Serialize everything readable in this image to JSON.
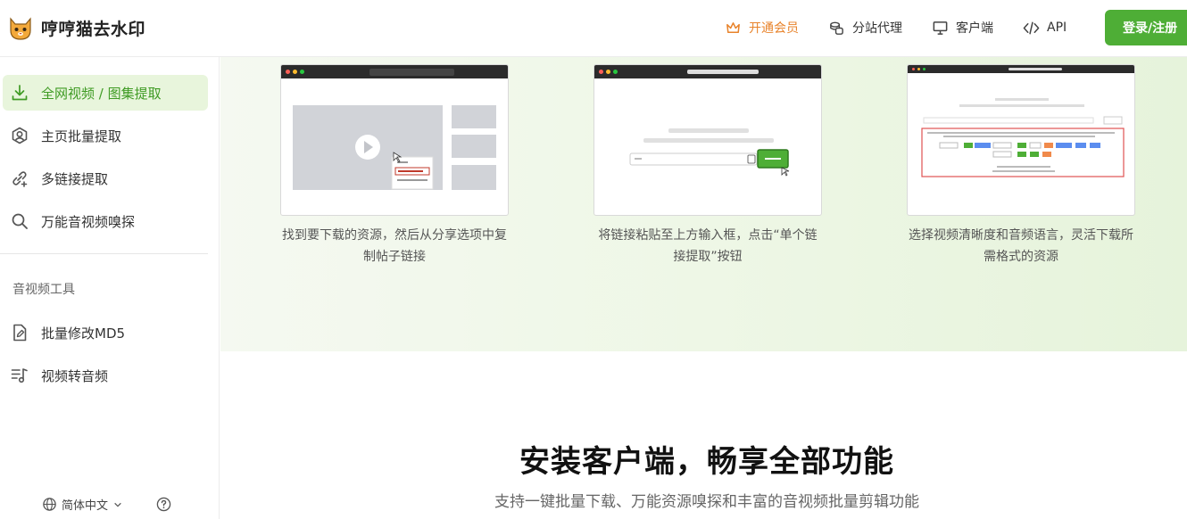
{
  "brand": {
    "name": "哼哼猫去水印"
  },
  "nav": {
    "vip": "开通会员",
    "agent": "分站代理",
    "client": "客户端",
    "api": "API",
    "login": "登录/注册"
  },
  "sidebar": {
    "items": [
      {
        "label": "全网视频 / 图集提取",
        "icon": "download-icon"
      },
      {
        "label": "主页批量提取",
        "icon": "user-circle-icon"
      },
      {
        "label": "多链接提取",
        "icon": "link-add-icon"
      },
      {
        "label": "万能音视频嗅探",
        "icon": "search-icon"
      }
    ],
    "section_title": "音视频工具",
    "tools": [
      {
        "label": "批量修改MD5",
        "icon": "file-edit-icon"
      },
      {
        "label": "视频转音频",
        "icon": "music-list-icon"
      }
    ],
    "language": "简体中文"
  },
  "steps": [
    {
      "caption": "找到要下载的资源，然后从分享选项中复制帖子链接"
    },
    {
      "caption": "将链接粘贴至上方输入框，点击“单个链接提取”按钮"
    },
    {
      "caption": "选择视频清晰度和音频语言，灵活下载所需格式的资源"
    }
  ],
  "client_section": {
    "title": "安装客户端，畅享全部功能",
    "subtitle": "支持一键批量下载、万能资源嗅探和丰富的音视频批量剪辑功能"
  },
  "colors": {
    "accent": "#4eae36",
    "vip": "#e8832b",
    "active_bg": "#e8f5dc"
  }
}
